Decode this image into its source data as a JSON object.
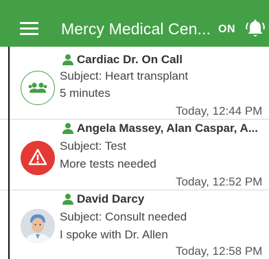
{
  "app_bar": {
    "title": "Mercy Medical Cen...",
    "status": "ON"
  },
  "colors": {
    "primary": "#43a047",
    "alert": "#e53935",
    "text": "#333333"
  },
  "messages": [
    {
      "avatar_icon": "group-icon",
      "sender": "Cardiac Dr. On Call",
      "subject": "Subject: Heart transplant",
      "preview": "5 minutes",
      "time": "Today, 12:44 PM"
    },
    {
      "avatar_icon": "warning-icon",
      "sender": "Angela Massey, Alan Caspar, A...",
      "subject": "Subject: Test",
      "preview": "More tests needed",
      "time": "Today, 12:52 PM"
    },
    {
      "avatar_icon": "doctor-photo",
      "sender": "David Darcy",
      "subject": "Subject: Consult needed",
      "preview": "I spoke with Dr. Allen",
      "time": "Today, 12:58 PM"
    }
  ]
}
